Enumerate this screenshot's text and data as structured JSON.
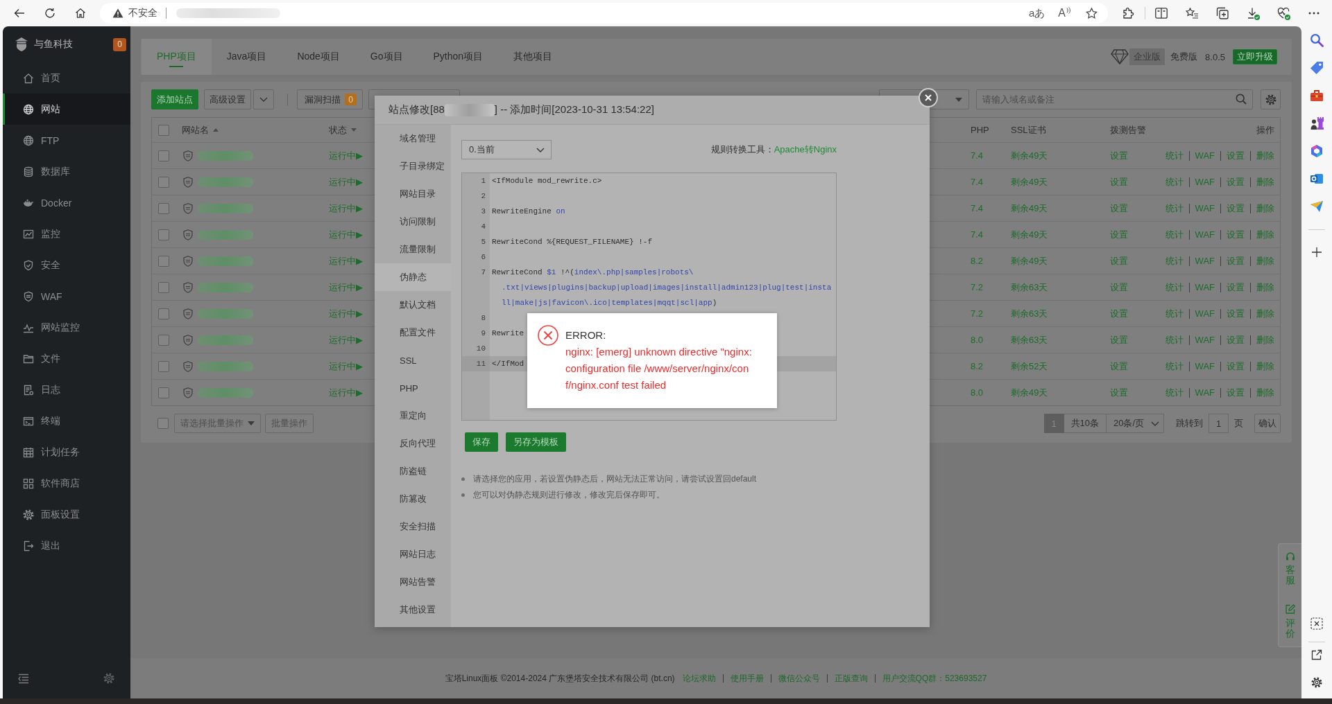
{
  "browser": {
    "security_label": "不安全",
    "translate_button": "aあ",
    "read_aloud_button": "A"
  },
  "sidebar": {
    "brand": "与鱼科技",
    "badge": "0",
    "items": [
      {
        "label": "首页",
        "selected": false
      },
      {
        "label": "网站",
        "selected": true
      },
      {
        "label": "FTP",
        "selected": false
      },
      {
        "label": "数据库",
        "selected": false
      },
      {
        "label": "Docker",
        "selected": false
      },
      {
        "label": "监控",
        "selected": false
      },
      {
        "label": "安全",
        "selected": false
      },
      {
        "label": "WAF",
        "selected": false
      },
      {
        "label": "网站监控",
        "selected": false
      },
      {
        "label": "文件",
        "selected": false
      },
      {
        "label": "日志",
        "selected": false
      },
      {
        "label": "终端",
        "selected": false
      },
      {
        "label": "计划任务",
        "selected": false
      },
      {
        "label": "软件商店",
        "selected": false
      },
      {
        "label": "面板设置",
        "selected": false
      },
      {
        "label": "退出",
        "selected": false
      }
    ]
  },
  "tabs": [
    {
      "label": "PHP项目",
      "selected": true
    },
    {
      "label": "Java项目",
      "selected": false
    },
    {
      "label": "Node项目",
      "selected": false
    },
    {
      "label": "Go项目",
      "selected": false
    },
    {
      "label": "Python项目",
      "selected": false
    },
    {
      "label": "其他项目",
      "selected": false
    }
  ],
  "edition": {
    "enterprise": "企业版",
    "free": "免费版",
    "version": "8.0.5",
    "upgrade_button": "立即升级"
  },
  "toolbar": {
    "add_site_button": "添加站点",
    "advanced_button": "高级设置",
    "scan_button": "漏洞扫描",
    "scan_count": "0",
    "search": {
      "placeholder": "请输入域名或备注"
    }
  },
  "table": {
    "header_checked": false,
    "columns": [
      "网站名",
      "状态",
      "PHP",
      "SSL证书",
      "拨测告警",
      "操作"
    ],
    "rows": [
      {
        "checked": false,
        "status": "运行中▶",
        "php": "7.4",
        "ssl": "剩余49天",
        "alert": "设置",
        "actions": [
          "统计",
          "WAF",
          "设置",
          "删除"
        ]
      },
      {
        "checked": false,
        "status": "运行中▶",
        "php": "7.4",
        "ssl": "剩余49天",
        "alert": "设置",
        "actions": [
          "统计",
          "WAF",
          "设置",
          "删除"
        ]
      },
      {
        "checked": false,
        "status": "运行中▶",
        "php": "7.4",
        "ssl": "剩余49天",
        "alert": "设置",
        "actions": [
          "统计",
          "WAF",
          "设置",
          "删除"
        ]
      },
      {
        "checked": false,
        "status": "运行中▶",
        "php": "7.4",
        "ssl": "剩余49天",
        "alert": "设置",
        "actions": [
          "统计",
          "WAF",
          "设置",
          "删除"
        ]
      },
      {
        "checked": false,
        "status": "运行中▶",
        "php": "8.2",
        "ssl": "剩余49天",
        "alert": "设置",
        "actions": [
          "统计",
          "WAF",
          "设置",
          "删除"
        ]
      },
      {
        "checked": false,
        "status": "运行中▶",
        "php": "7.2",
        "ssl": "剩余63天",
        "alert": "设置",
        "actions": [
          "统计",
          "WAF",
          "设置",
          "删除"
        ]
      },
      {
        "checked": false,
        "status": "运行中▶",
        "php": "7.2",
        "ssl": "剩余63天",
        "alert": "设置",
        "actions": [
          "统计",
          "WAF",
          "设置",
          "删除"
        ]
      },
      {
        "checked": false,
        "status": "运行中▶",
        "php": "8.0",
        "ssl": "剩余63天",
        "alert": "设置",
        "actions": [
          "统计",
          "WAF",
          "设置",
          "删除"
        ]
      },
      {
        "checked": false,
        "status": "运行中▶",
        "php": "8.2",
        "ssl": "剩余52天",
        "alert": "设置",
        "actions": [
          "统计",
          "WAF",
          "设置",
          "删除"
        ]
      },
      {
        "checked": false,
        "status": "运行中▶",
        "php": "8.0",
        "ssl": "剩余49天",
        "alert": "设置",
        "actions": [
          "统计",
          "WAF",
          "设置",
          "删除"
        ]
      }
    ]
  },
  "batch": {
    "checked": false,
    "placeholder": "请选择批量操作",
    "button": "批量操作"
  },
  "pagination": {
    "pages": [
      {
        "label": "1",
        "selected": true
      }
    ],
    "total": "共10条",
    "page_size": "20条/页",
    "goto_label": "跳转到",
    "goto_value": "1",
    "page_unit": "页",
    "confirm_button": "确认"
  },
  "side_widget": [
    "客服",
    "评价"
  ],
  "footer": {
    "copyright": "宝塔Linux面板 ©2014-2024 广东堡塔安全技术有限公司 (bt.cn)",
    "links": [
      "论坛求助",
      "使用手册",
      "微信公众号",
      "正版查询",
      "用户交流QQ群：523693527"
    ]
  },
  "dialog": {
    "title_start": "站点修改[88",
    "title_end": "] -- 添加时间[2023-10-31 13:54:22]",
    "nav": [
      {
        "label": "域名管理",
        "selected": false
      },
      {
        "label": "子目录绑定",
        "selected": false
      },
      {
        "label": "网站目录",
        "selected": false
      },
      {
        "label": "访问限制",
        "selected": false
      },
      {
        "label": "流量限制",
        "selected": false
      },
      {
        "label": "伪静态",
        "selected": true
      },
      {
        "label": "默认文档",
        "selected": false
      },
      {
        "label": "配置文件",
        "selected": false
      },
      {
        "label": "SSL",
        "selected": false
      },
      {
        "label": "PHP",
        "selected": false
      },
      {
        "label": "重定向",
        "selected": false
      },
      {
        "label": "反向代理",
        "selected": false
      },
      {
        "label": "防盗链",
        "selected": false
      },
      {
        "label": "防篡改",
        "selected": false
      },
      {
        "label": "安全扫描",
        "selected": false
      },
      {
        "label": "网站日志",
        "selected": false
      },
      {
        "label": "网站告警",
        "selected": false
      },
      {
        "label": "其他设置",
        "selected": false
      }
    ],
    "version_select": "0.当前",
    "converter_label": "规则转换工具：",
    "converter_link": "Apache转Nginx",
    "code_lines": [
      {
        "number": "1",
        "active": false,
        "visual_lines": [
          {
            "parts": [
              {
                "kind": "plain",
                "text": "<IfModule mod_rewrite.c>"
              }
            ]
          }
        ]
      },
      {
        "number": "2",
        "active": false
      },
      {
        "number": "3",
        "active": false,
        "visual_lines": [
          {
            "parts": [
              {
                "kind": "plain",
                "text": "RewriteEngine "
              },
              {
                "kind": "keyword",
                "text": "on"
              }
            ]
          }
        ]
      },
      {
        "number": "4",
        "active": false
      },
      {
        "number": "5",
        "active": false,
        "visual_lines": [
          {
            "parts": [
              {
                "kind": "plain",
                "text": "RewriteCond %{REQUEST_FILENAME} !-f"
              }
            ]
          }
        ]
      },
      {
        "number": "6",
        "active": false
      },
      {
        "number": "7",
        "active": false,
        "visual_lines": [
          {
            "parts": [
              {
                "kind": "plain",
                "text": "RewriteCond "
              },
              {
                "kind": "keyword",
                "text": "$1"
              },
              {
                "kind": "plain",
                "text": " !^("
              },
              {
                "kind": "keyword",
                "text": "index\\.php|samples|robots\\"
              }
            ]
          },
          {
            "parts": [
              {
                "kind": "keyword",
                "text": ".txt|views|plugins|backup|upload|images|install|admin123|plug|test|insta"
              }
            ]
          },
          {
            "parts": [
              {
                "kind": "keyword",
                "text": "ll|make|js|favicon\\.ico|templates|mqqt|scl|app"
              },
              {
                "kind": "plain",
                "text": ")"
              }
            ]
          }
        ]
      },
      {
        "number": "8",
        "active": false
      },
      {
        "number": "9",
        "active": false,
        "visual_lines": [
          {
            "parts": [
              {
                "kind": "plain",
                "text": "Rewrite"
              }
            ]
          }
        ]
      },
      {
        "number": "10",
        "active": false
      },
      {
        "number": "11",
        "active": true,
        "visual_lines": [
          {
            "parts": [
              {
                "kind": "plain",
                "text": "</IfMod"
              }
            ]
          }
        ]
      }
    ],
    "buttons": [
      "保存",
      "另存为模板"
    ],
    "notes": [
      "请选择您的应用，若设置伪静态后，网站无法正常访问，请尝试设置回default",
      "您可以对伪静态规则进行修改，修改完后保存即可。"
    ]
  },
  "error_toast": {
    "title": "ERROR:",
    "message": "nginx: [emerg] unknown directive \"nginx: configuration file /www/server/nginx/conf/nginx.conf test failed"
  }
}
